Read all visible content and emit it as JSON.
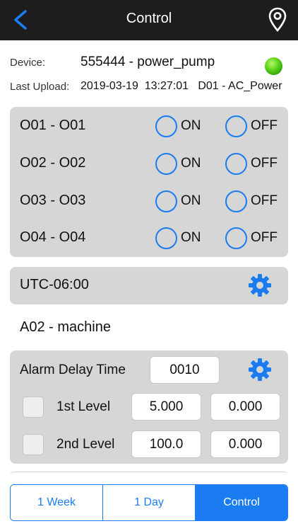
{
  "nav": {
    "title": "Control",
    "back_icon": "chevron-left-icon",
    "location_icon": "map-pin-icon"
  },
  "device": {
    "device_label": "Device:",
    "device_value": "555444 - power_pump",
    "status_color": "#3fbf0f",
    "upload_label": "Last Upload:",
    "upload_value": "2019-03-19  13:27:01   D01 - AC_Power"
  },
  "outputs": [
    {
      "name": "O01 - O01",
      "on_label": "ON",
      "off_label": "OFF"
    },
    {
      "name": "O02 - O02",
      "on_label": "ON",
      "off_label": "OFF"
    },
    {
      "name": "O03 - O03",
      "on_label": "ON",
      "off_label": "OFF"
    },
    {
      "name": "O04 - O04",
      "on_label": "ON",
      "off_label": "OFF"
    }
  ],
  "timezone": {
    "value": "UTC-06:00",
    "settings_icon": "gear-icon"
  },
  "analog": {
    "name": "A02 - machine"
  },
  "alarm": {
    "delay_label": "Alarm Delay Time",
    "delay_value": "0010",
    "levels": [
      {
        "label": "1st Level",
        "value_a": "5.000",
        "value_b": "0.000"
      },
      {
        "label": "2nd Level",
        "value_a": "100.0",
        "value_b": "0.000"
      }
    ]
  },
  "tabs": [
    {
      "label": "1 Week",
      "active": false
    },
    {
      "label": "1 Day",
      "active": false
    },
    {
      "label": "Control",
      "active": true
    }
  ],
  "colors": {
    "accent": "#1a7cf0",
    "nav_bg": "#1d1d1d",
    "panel_bg": "#d6d6d6"
  }
}
